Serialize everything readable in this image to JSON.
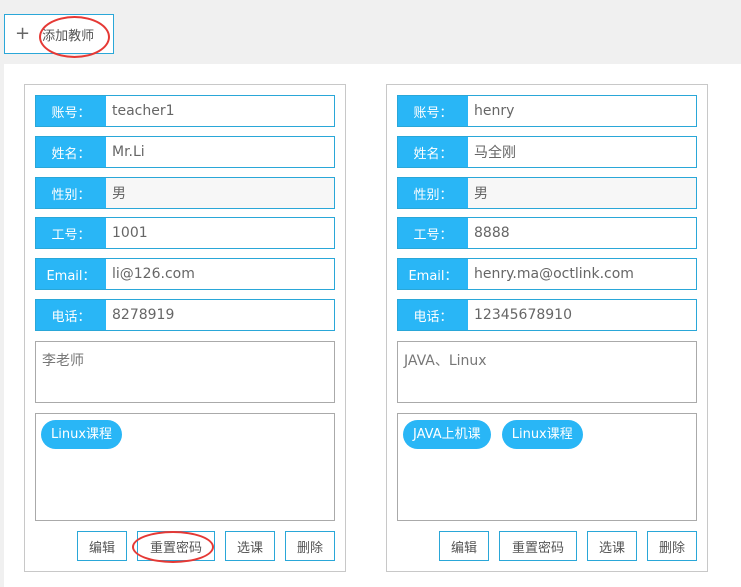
{
  "toolbar": {
    "add_icon": "+",
    "add_label": "添加教师"
  },
  "labels": {
    "account": "账号：",
    "name": "姓名：",
    "gender": "性别：",
    "employee_no": "工号：",
    "email": "Email：",
    "phone": "电话："
  },
  "actions": {
    "edit": "编辑",
    "reset_password": "重置密码",
    "select_courses": "选课",
    "delete": "删除"
  },
  "teachers": [
    {
      "account": "teacher1",
      "name": "Mr.Li",
      "gender": "男",
      "employee_no": "1001",
      "email": "li@126.com",
      "phone": "8278919",
      "remark": "李老师",
      "courses": [
        "Linux课程"
      ]
    },
    {
      "account": "henry",
      "name": "马全刚",
      "gender": "男",
      "employee_no": "8888",
      "email": "henry.ma@octlink.com",
      "phone": "12345678910",
      "remark": "JAVA、Linux",
      "courses": [
        "JAVA上机课",
        "Linux课程"
      ]
    }
  ],
  "colors": {
    "accent": "#29b6f6",
    "border": "#2aa7d8",
    "annotation": "#e53935"
  }
}
